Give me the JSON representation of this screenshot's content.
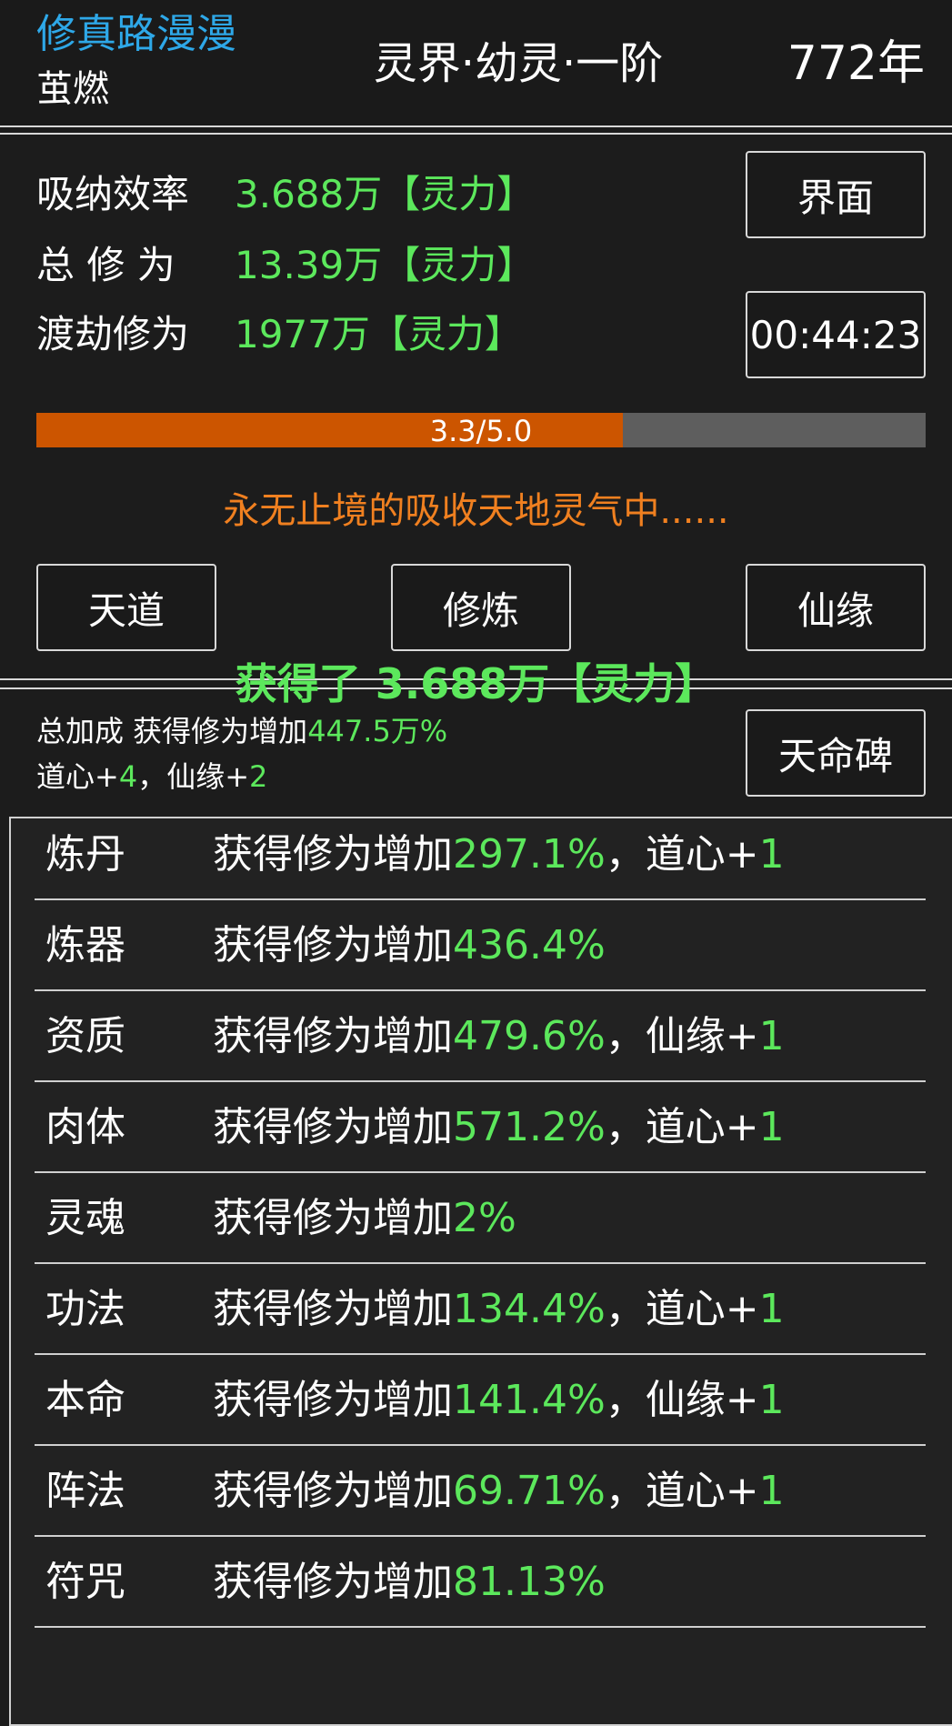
{
  "header": {
    "game_title": "修真路漫漫",
    "player_name": "茧燃",
    "realm": "灵界·幼灵·一阶",
    "year": "772年"
  },
  "stats": [
    {
      "label": "吸纳效率",
      "value": "3.688万【灵力】"
    },
    {
      "label": "总 修 为",
      "value": "13.39万【灵力】"
    },
    {
      "label": "渡劫修为",
      "value": "1977万【灵力】"
    }
  ],
  "buttons": {
    "interface": "界面",
    "timer": "00:44:23",
    "tiandao": "天道",
    "xiulian": "修炼",
    "xianyuan": "仙缘",
    "tianmingbei": "天命碑"
  },
  "progress": {
    "text": "3.3/5.0",
    "current": 3.3,
    "max": 5.0,
    "fill_color": "#cc5500"
  },
  "status_message": "永无止境的吸收天地灵气中......",
  "gain_message": "获得了 3.688万【灵力】",
  "bonus": {
    "line1_prefix": "总加成 获得修为增加",
    "line1_value": "447.5万%",
    "daoxin_label": "道心+",
    "daoxin_value": "4",
    "separator": "，",
    "xianyuan_label": "仙缘+",
    "xianyuan_value": "2"
  },
  "list": [
    {
      "name": "炼丹",
      "prefix": "获得修为增加",
      "value": "297.1%",
      "extra_label": "，道心+",
      "extra_value": "1"
    },
    {
      "name": "炼器",
      "prefix": "获得修为增加",
      "value": "436.4%",
      "extra_label": "",
      "extra_value": ""
    },
    {
      "name": "资质",
      "prefix": "获得修为增加",
      "value": "479.6%",
      "extra_label": "，仙缘+",
      "extra_value": "1"
    },
    {
      "name": "肉体",
      "prefix": "获得修为增加",
      "value": "571.2%",
      "extra_label": "，道心+",
      "extra_value": "1"
    },
    {
      "name": "灵魂",
      "prefix": "获得修为增加",
      "value": "2%",
      "extra_label": "",
      "extra_value": ""
    },
    {
      "name": "功法",
      "prefix": "获得修为增加",
      "value": "134.4%",
      "extra_label": "，道心+",
      "extra_value": "1"
    },
    {
      "name": "本命",
      "prefix": "获得修为增加",
      "value": "141.4%",
      "extra_label": "，仙缘+",
      "extra_value": "1"
    },
    {
      "name": "阵法",
      "prefix": "获得修为增加",
      "value": "69.71%",
      "extra_label": "，道心+",
      "extra_value": "1"
    },
    {
      "name": "符咒",
      "prefix": "获得修为增加",
      "value": "81.13%",
      "extra_label": "",
      "extra_value": ""
    }
  ]
}
